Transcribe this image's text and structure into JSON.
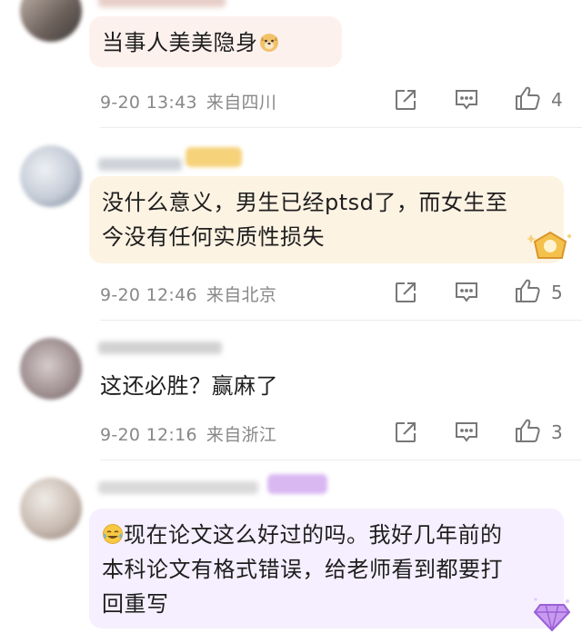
{
  "comments": [
    {
      "text": "当事人美美隐身",
      "emoji": "doge-emoji",
      "time": "9-20 13:43",
      "location": "来自四川",
      "likes": "4"
    },
    {
      "text": "没什么意义，男生已经ptsd了，而女生至\n今没有任何实质性损失",
      "time": "9-20 12:46",
      "location": "来自北京",
      "likes": "5"
    },
    {
      "text": "这还必胜？赢麻了",
      "time": "9-20 12:16",
      "location": "来自浙江",
      "likes": "3"
    },
    {
      "emoji": "crying-laughing-emoji",
      "text": "现在论文这么好过的吗。我好几年前的\n本科论文有格式错误，给老师看到都要打\n回重写"
    }
  ],
  "icons": {
    "share": "share-icon",
    "comment": "comment-icon",
    "like": "thumbs-up-icon"
  },
  "colors": {
    "bubble_pink": "#fdf1ee",
    "bubble_gold": "#fdf3e3",
    "bubble_purple": "#f5efff",
    "meta_gray": "#888888"
  }
}
